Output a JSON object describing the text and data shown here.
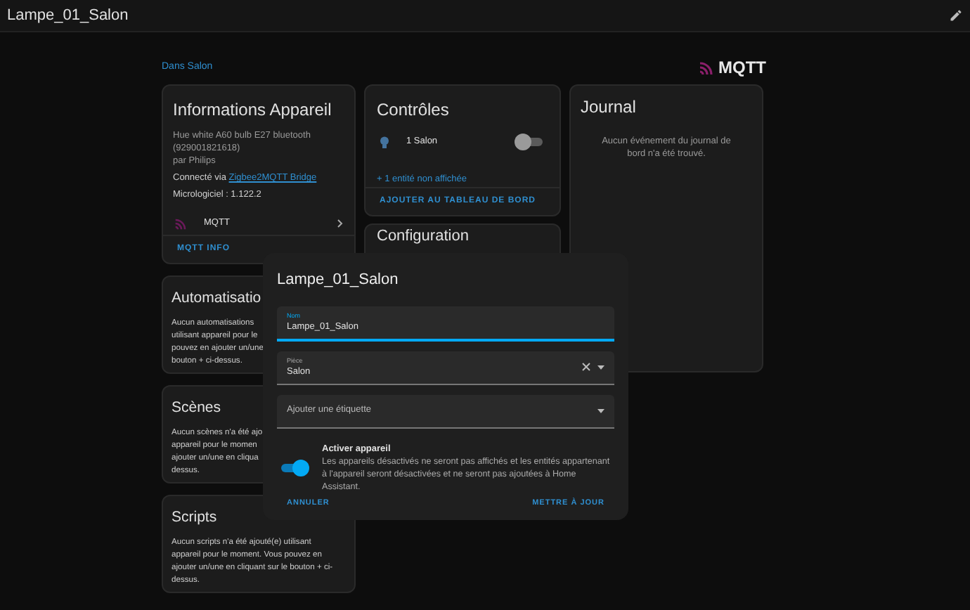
{
  "top_bar": {
    "title": "Lampe_01_Salon"
  },
  "breadcrumb": "Dans Salon",
  "logo": "MQTT",
  "device_info": {
    "title": "Informations Appareil",
    "model_lines": [
      "Hue white A60 bulb E27 bluetooth",
      "(929001821618)",
      "par Philips"
    ],
    "connected_label": "Connecté via",
    "connected_link": "Zigbee2MQTT Bridge",
    "firmware": "Micrologiciel : 1.122.2",
    "integration": "MQTT",
    "action": "MQTT INFO"
  },
  "controls": {
    "title": "Contrôles",
    "entity": {
      "name": "1 Salon",
      "on": false
    },
    "hidden_link": "+ 1 entité non affichée",
    "action": "AJOUTER AU TABLEAU DE BORD"
  },
  "configuration": {
    "title": "Configuration"
  },
  "journal": {
    "title": "Journal",
    "empty": "Aucun événement du journal de bord n'a été trouvé."
  },
  "left_cards": [
    {
      "title": "Automatisatio",
      "lines": [
        "Aucun automatisations",
        "utilisant appareil pour le",
        "pouvez en ajouter un/une",
        "bouton + ci-dessus."
      ]
    },
    {
      "title": "Scènes",
      "lines": [
        "Aucun scènes n'a été ajo",
        "appareil pour le momen",
        "ajouter un/une en cliqua",
        "dessus."
      ]
    },
    {
      "title": "Scripts",
      "lines": [
        "Aucun scripts n'a été ajouté(e) utilisant",
        "appareil pour le moment. Vous pouvez en",
        "ajouter un/une en cliquant sur le bouton + ci-",
        "dessus."
      ]
    }
  ],
  "dialog": {
    "title": "Lampe_01_Salon",
    "name_field": {
      "label": "Nom",
      "value": "Lampe_01_Salon"
    },
    "area_field": {
      "label": "Pièce",
      "value": "Salon"
    },
    "label_field": {
      "placeholder": "Ajouter une étiquette"
    },
    "enable": {
      "label": "Activer appareil",
      "description": "Les appareils désactivés ne seront pas affichés et les entités appartenant à l'appareil seront désactivées et ne seront pas ajoutées à Home Assistant.",
      "on": true
    },
    "buttons": [
      "ANNULER",
      "METTRE À JOUR"
    ]
  }
}
